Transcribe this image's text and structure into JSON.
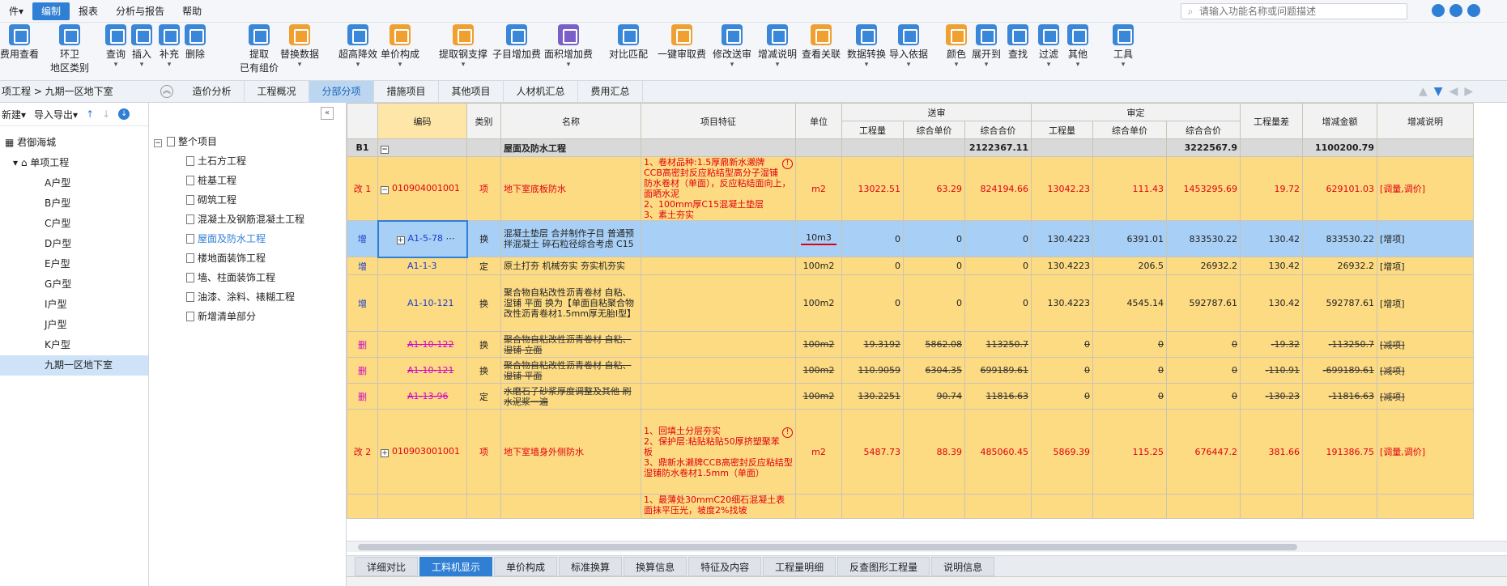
{
  "menu": [
    "件▾",
    "编制",
    "报表",
    "分析与报告",
    "帮助"
  ],
  "search": {
    "placeholder": "请输入功能名称或问题描述"
  },
  "toolbar": [
    {
      "label": "费用查看",
      "icon": "blue"
    },
    {
      "label": "环卫\n地区类别",
      "icon": "blue"
    },
    {
      "label": "查询",
      "icon": "blue",
      "arrow": true
    },
    {
      "label": "插入",
      "icon": "blue",
      "arrow": true
    },
    {
      "label": "补充",
      "icon": "blue",
      "arrow": true
    },
    {
      "label": "删除",
      "icon": "blue"
    },
    {
      "label": "提取\n已有组价",
      "icon": "blue"
    },
    {
      "label": "替换数据",
      "icon": "orange",
      "arrow": true
    },
    {
      "label": "超高降效",
      "icon": "blue",
      "arrow": true
    },
    {
      "label": "单价构成",
      "icon": "orange",
      "arrow": true
    },
    {
      "label": "提取钢支撑",
      "icon": "orange",
      "arrow": true
    },
    {
      "label": "子目增加费",
      "icon": "blue"
    },
    {
      "label": "面积增加费",
      "icon": "purple",
      "arrow": true
    },
    {
      "label": "对比匹配",
      "icon": "blue"
    },
    {
      "label": "一键审取费",
      "icon": "orange"
    },
    {
      "label": "修改送审",
      "icon": "blue",
      "arrow": true
    },
    {
      "label": "增减说明",
      "icon": "blue",
      "arrow": true
    },
    {
      "label": "查看关联",
      "icon": "orange"
    },
    {
      "label": "数据转换",
      "icon": "blue",
      "arrow": true
    },
    {
      "label": "导入依据",
      "icon": "blue",
      "arrow": true
    },
    {
      "label": "颜色",
      "icon": "orange",
      "arrow": true
    },
    {
      "label": "展开到",
      "icon": "blue",
      "arrow": true
    },
    {
      "label": "查找",
      "icon": "blue"
    },
    {
      "label": "过滤",
      "icon": "blue",
      "arrow": true
    },
    {
      "label": "其他",
      "icon": "blue",
      "arrow": true
    },
    {
      "label": "工具",
      "icon": "blue",
      "arrow": true
    }
  ],
  "breadcrumb": "项工程 > 九期一区地下室",
  "main_tabs": [
    "造价分析",
    "工程概况",
    "分部分项",
    "措施项目",
    "其他项目",
    "人材机汇总",
    "费用汇总"
  ],
  "active_tab": "分部分项",
  "left_toolbar": {
    "new": "新建▾",
    "import": "导入导出▾"
  },
  "left_tree": {
    "root": "君御海城",
    "group": "单项工程",
    "items": [
      "A户型",
      "B户型",
      "C户型",
      "D户型",
      "E户型",
      "G户型",
      "I户型",
      "J户型",
      "K户型",
      "九期一区地下室"
    ],
    "selected": "九期一区地下室"
  },
  "mid_tree": {
    "root": "整个项目",
    "items": [
      "土石方工程",
      "桩基工程",
      "砌筑工程",
      "混凝土及钢筋混凝土工程",
      "屋面及防水工程",
      "楼地面装饰工程",
      "墙、柱面装饰工程",
      "油漆、涂料、裱糊工程",
      "新增清单部分"
    ],
    "selected": "屋面及防水工程"
  },
  "grid": {
    "headers": {
      "code": "编码",
      "type": "类别",
      "name": "名称",
      "feature": "项目特征",
      "unit": "单位",
      "sent": "送审",
      "approved": "审定",
      "qty": "工程量",
      "uprice": "综合单价",
      "total": "综合合价",
      "qty_diff": "工程量差",
      "amt_diff": "增减金额",
      "note": "增减说明"
    },
    "b1": {
      "mark": "B1",
      "name": "屋面及防水工程",
      "sent_total": "2122367.11",
      "app_total": "3222567.9",
      "amt_diff": "1100200.79"
    },
    "rows": [
      {
        "kind": "item",
        "mark": "改 1",
        "code": "010904001001",
        "type": "项",
        "name": "地下室底板防水",
        "feature": "1、卷材品种:1.5厚鼎新水濑牌CCB高密封反应粘结型高分子湿铺防水卷材（单面），反应粘结面向上，面晒水泥\n2、100mm厚C15混凝土垫层\n3、素土夯实",
        "unit": "m2",
        "s_qty": "13022.51",
        "s_price": "63.29",
        "s_total": "824194.66",
        "a_qty": "13042.23",
        "a_price": "111.43",
        "a_total": "1453295.69",
        "q_diff": "19.72",
        "m_diff": "629101.03",
        "note": "[调量,调价]"
      },
      {
        "kind": "sel",
        "mark": "增",
        "code": "A1-5-78",
        "type": "换",
        "name": "混凝土垫层 合并制作子目 普通预拌混凝土 碎石粒径综合考虑 C15",
        "unit": "10m3",
        "s_qty": "0",
        "s_price": "0",
        "s_total": "0",
        "a_qty": "130.4223",
        "a_price": "6391.01",
        "a_total": "833530.22",
        "q_diff": "130.42",
        "m_diff": "833530.22",
        "note": "[增项]"
      },
      {
        "kind": "add",
        "mark": "增",
        "code": "A1-1-3",
        "type": "定",
        "name": "原土打夯 机械夯实 夯实机夯实",
        "unit": "100m2",
        "s_qty": "0",
        "s_price": "0",
        "s_total": "0",
        "a_qty": "130.4223",
        "a_price": "206.5",
        "a_total": "26932.2",
        "q_diff": "130.42",
        "m_diff": "26932.2",
        "note": "[增项]"
      },
      {
        "kind": "add",
        "mark": "增",
        "code": "A1-10-121",
        "type": "换",
        "name": "聚合物自粘改性沥青卷材 自粘、湿铺 平面 换为【单面自粘聚合物改性沥青卷材1.5mm厚无胎I型】",
        "unit": "100m2",
        "s_qty": "0",
        "s_price": "0",
        "s_total": "0",
        "a_qty": "130.4223",
        "a_price": "4545.14",
        "a_total": "592787.61",
        "q_diff": "130.42",
        "m_diff": "592787.61",
        "note": "[增项]"
      },
      {
        "kind": "del",
        "mark": "删",
        "code": "A1-10-122",
        "type": "换",
        "name": "聚合物自粘改性沥青卷材 自粘、湿铺 立面",
        "unit": "100m2",
        "s_qty": "19.3192",
        "s_price": "5862.08",
        "s_total": "113250.7",
        "a_qty": "0",
        "a_price": "0",
        "a_total": "0",
        "q_diff": "-19.32",
        "m_diff": "-113250.7",
        "note": "[减项]"
      },
      {
        "kind": "del",
        "mark": "删",
        "code": "A1-10-121",
        "type": "换",
        "name": "聚合物自粘改性沥青卷材 自粘、湿铺 平面",
        "unit": "100m2",
        "s_qty": "110.9059",
        "s_price": "6304.35",
        "s_total": "699189.61",
        "a_qty": "0",
        "a_price": "0",
        "a_total": "0",
        "q_diff": "-110.91",
        "m_diff": "-699189.61",
        "note": "[减项]"
      },
      {
        "kind": "del",
        "mark": "删",
        "code": "A1-13-96",
        "type": "定",
        "name": "水磨石子砂浆厚度调整及其他 刷水泥浆一遍",
        "unit": "100m2",
        "s_qty": "130.2251",
        "s_price": "90.74",
        "s_total": "11816.63",
        "a_qty": "0",
        "a_price": "0",
        "a_total": "0",
        "q_diff": "-130.23",
        "m_diff": "-11816.63",
        "note": "[减项]"
      },
      {
        "kind": "item",
        "mark": "改 2",
        "code": "010903001001",
        "type": "项",
        "name": "地下室墙身外侧防水",
        "feature": "1、回填土分层夯实\n2、保护层:粘贴粘贴50厚挤塑聚苯板\n3、鼎新水濑牌CCB高密封反应粘结型湿铺防水卷材1.5mm（单面）",
        "unit": "m2",
        "s_qty": "5487.73",
        "s_price": "88.39",
        "s_total": "485060.45",
        "a_qty": "5869.39",
        "a_price": "115.25",
        "a_total": "676447.2",
        "q_diff": "381.66",
        "m_diff": "191386.75",
        "note": "[调量,调价]"
      },
      {
        "kind": "partial",
        "feature": "1、最薄处30mmC20细石混凝土表面抹平压光，坡度2%找坡"
      }
    ]
  },
  "bottom_tabs": [
    "详细对比",
    "工料机显示",
    "单价构成",
    "标准换算",
    "换算信息",
    "特征及内容",
    "工程量明细",
    "反查图形工程量",
    "说明信息"
  ],
  "active_bottom_tab": "工料机显示"
}
